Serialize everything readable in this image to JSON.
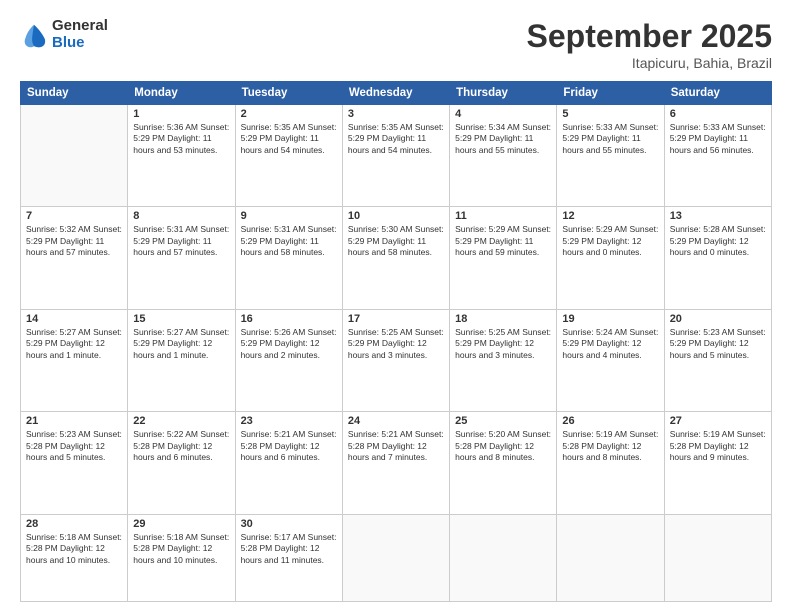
{
  "header": {
    "logo_line1": "General",
    "logo_line2": "Blue",
    "month": "September 2025",
    "location": "Itapicuru, Bahia, Brazil"
  },
  "weekdays": [
    "Sunday",
    "Monday",
    "Tuesday",
    "Wednesday",
    "Thursday",
    "Friday",
    "Saturday"
  ],
  "weeks": [
    [
      {
        "day": "",
        "detail": ""
      },
      {
        "day": "1",
        "detail": "Sunrise: 5:36 AM\nSunset: 5:29 PM\nDaylight: 11 hours\nand 53 minutes."
      },
      {
        "day": "2",
        "detail": "Sunrise: 5:35 AM\nSunset: 5:29 PM\nDaylight: 11 hours\nand 54 minutes."
      },
      {
        "day": "3",
        "detail": "Sunrise: 5:35 AM\nSunset: 5:29 PM\nDaylight: 11 hours\nand 54 minutes."
      },
      {
        "day": "4",
        "detail": "Sunrise: 5:34 AM\nSunset: 5:29 PM\nDaylight: 11 hours\nand 55 minutes."
      },
      {
        "day": "5",
        "detail": "Sunrise: 5:33 AM\nSunset: 5:29 PM\nDaylight: 11 hours\nand 55 minutes."
      },
      {
        "day": "6",
        "detail": "Sunrise: 5:33 AM\nSunset: 5:29 PM\nDaylight: 11 hours\nand 56 minutes."
      }
    ],
    [
      {
        "day": "7",
        "detail": "Sunrise: 5:32 AM\nSunset: 5:29 PM\nDaylight: 11 hours\nand 57 minutes."
      },
      {
        "day": "8",
        "detail": "Sunrise: 5:31 AM\nSunset: 5:29 PM\nDaylight: 11 hours\nand 57 minutes."
      },
      {
        "day": "9",
        "detail": "Sunrise: 5:31 AM\nSunset: 5:29 PM\nDaylight: 11 hours\nand 58 minutes."
      },
      {
        "day": "10",
        "detail": "Sunrise: 5:30 AM\nSunset: 5:29 PM\nDaylight: 11 hours\nand 58 minutes."
      },
      {
        "day": "11",
        "detail": "Sunrise: 5:29 AM\nSunset: 5:29 PM\nDaylight: 11 hours\nand 59 minutes."
      },
      {
        "day": "12",
        "detail": "Sunrise: 5:29 AM\nSunset: 5:29 PM\nDaylight: 12 hours\nand 0 minutes."
      },
      {
        "day": "13",
        "detail": "Sunrise: 5:28 AM\nSunset: 5:29 PM\nDaylight: 12 hours\nand 0 minutes."
      }
    ],
    [
      {
        "day": "14",
        "detail": "Sunrise: 5:27 AM\nSunset: 5:29 PM\nDaylight: 12 hours\nand 1 minute."
      },
      {
        "day": "15",
        "detail": "Sunrise: 5:27 AM\nSunset: 5:29 PM\nDaylight: 12 hours\nand 1 minute."
      },
      {
        "day": "16",
        "detail": "Sunrise: 5:26 AM\nSunset: 5:29 PM\nDaylight: 12 hours\nand 2 minutes."
      },
      {
        "day": "17",
        "detail": "Sunrise: 5:25 AM\nSunset: 5:29 PM\nDaylight: 12 hours\nand 3 minutes."
      },
      {
        "day": "18",
        "detail": "Sunrise: 5:25 AM\nSunset: 5:29 PM\nDaylight: 12 hours\nand 3 minutes."
      },
      {
        "day": "19",
        "detail": "Sunrise: 5:24 AM\nSunset: 5:29 PM\nDaylight: 12 hours\nand 4 minutes."
      },
      {
        "day": "20",
        "detail": "Sunrise: 5:23 AM\nSunset: 5:29 PM\nDaylight: 12 hours\nand 5 minutes."
      }
    ],
    [
      {
        "day": "21",
        "detail": "Sunrise: 5:23 AM\nSunset: 5:28 PM\nDaylight: 12 hours\nand 5 minutes."
      },
      {
        "day": "22",
        "detail": "Sunrise: 5:22 AM\nSunset: 5:28 PM\nDaylight: 12 hours\nand 6 minutes."
      },
      {
        "day": "23",
        "detail": "Sunrise: 5:21 AM\nSunset: 5:28 PM\nDaylight: 12 hours\nand 6 minutes."
      },
      {
        "day": "24",
        "detail": "Sunrise: 5:21 AM\nSunset: 5:28 PM\nDaylight: 12 hours\nand 7 minutes."
      },
      {
        "day": "25",
        "detail": "Sunrise: 5:20 AM\nSunset: 5:28 PM\nDaylight: 12 hours\nand 8 minutes."
      },
      {
        "day": "26",
        "detail": "Sunrise: 5:19 AM\nSunset: 5:28 PM\nDaylight: 12 hours\nand 8 minutes."
      },
      {
        "day": "27",
        "detail": "Sunrise: 5:19 AM\nSunset: 5:28 PM\nDaylight: 12 hours\nand 9 minutes."
      }
    ],
    [
      {
        "day": "28",
        "detail": "Sunrise: 5:18 AM\nSunset: 5:28 PM\nDaylight: 12 hours\nand 10 minutes."
      },
      {
        "day": "29",
        "detail": "Sunrise: 5:18 AM\nSunset: 5:28 PM\nDaylight: 12 hours\nand 10 minutes."
      },
      {
        "day": "30",
        "detail": "Sunrise: 5:17 AM\nSunset: 5:28 PM\nDaylight: 12 hours\nand 11 minutes."
      },
      {
        "day": "",
        "detail": ""
      },
      {
        "day": "",
        "detail": ""
      },
      {
        "day": "",
        "detail": ""
      },
      {
        "day": "",
        "detail": ""
      }
    ]
  ]
}
